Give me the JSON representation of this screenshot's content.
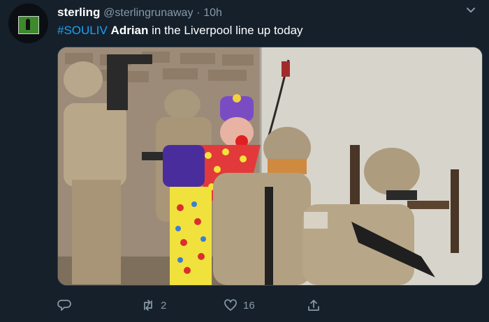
{
  "tweet": {
    "author_name": "sterling",
    "author_handle": "@sterlingrunaway",
    "separator": "·",
    "timestamp": "10h",
    "hashtag": "#SOULIV",
    "body_bold": "Adrian",
    "body_rest": " in the Liverpool line up today"
  },
  "actions": {
    "reply_count": "",
    "retweet_count": "2",
    "like_count": "16"
  },
  "icons": {
    "avatar": "avatar",
    "menu": "chevron-down-icon",
    "reply": "reply-icon",
    "retweet": "retweet-icon",
    "like": "heart-icon",
    "share": "share-icon"
  },
  "colors": {
    "background": "#15202b",
    "text": "#ffffff",
    "secondary": "#8899a6",
    "link": "#1da1f2"
  }
}
